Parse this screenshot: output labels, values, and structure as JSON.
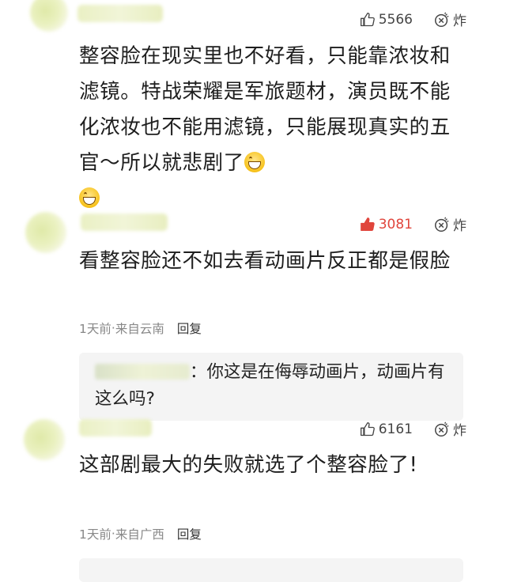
{
  "comments": [
    {
      "likes": "5566",
      "like_active": false,
      "bomb_label": "炸",
      "text": "整容脸在现实里也不好看，只能靠浓妆和滤镜。特战荣耀是军旅题材，演员既不能化浓妆也不能用滤镜，只能展现真实的五官～所以就悲剧了"
    },
    {
      "likes": "3081",
      "like_active": true,
      "bomb_label": "炸",
      "text": "看整容脸还不如去看动画片反正都是假脸",
      "time": "1天前",
      "location": "来自云南",
      "reply_label": "回复",
      "reply_text": "：你这是在侮辱动画片，动画片有这么吗?"
    },
    {
      "likes": "6161",
      "like_active": false,
      "bomb_label": "炸",
      "text": "这部剧最大的失败就选了个整容脸了!",
      "time": "1天前",
      "location": "来自广西",
      "reply_label": "回复"
    }
  ],
  "separator": " · ",
  "colors": {
    "like_active": "#e0453c",
    "reply_bg": "#f4f4f4",
    "meta": "#888888"
  },
  "icons": {
    "like": "thumbs-up-icon",
    "bomb": "bomb-icon",
    "emoji": "grinning-face-emoji"
  }
}
